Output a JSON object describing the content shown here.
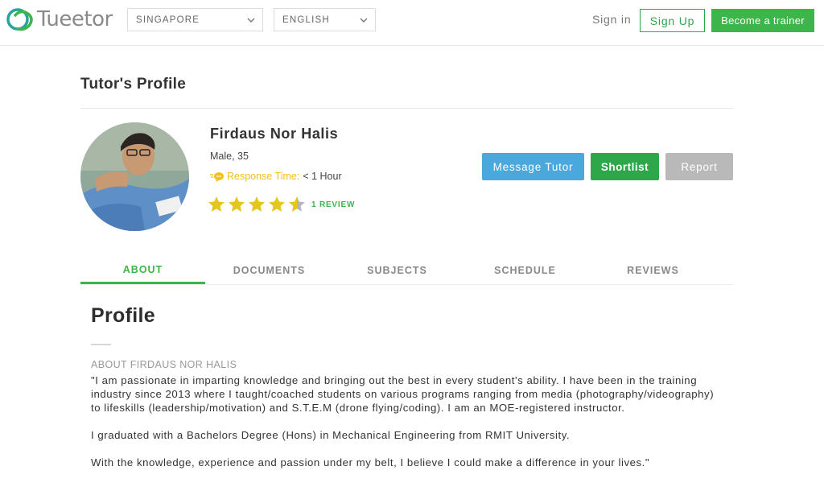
{
  "header": {
    "logo_text": "Tueetor",
    "country": "SINGAPORE",
    "language": "ENGLISH",
    "sign_in": "Sign in",
    "sign_up": "Sign Up",
    "become_trainer": "Become a trainer",
    "brand_color": "#3cb54a"
  },
  "page_title": "Tutor's Profile",
  "tutor": {
    "name": "Firdaus Nor Halis",
    "meta": "Male, 35",
    "response_label": "Response Time:",
    "response_value": "< 1 Hour",
    "rating": 4.5,
    "rating_max": 5,
    "review_link": "1 REVIEW"
  },
  "actions": {
    "message": "Message Tutor",
    "shortlist": "Shortlist",
    "report": "Report"
  },
  "tabs": [
    {
      "label": "ABOUT",
      "active": true
    },
    {
      "label": "DOCUMENTS",
      "active": false
    },
    {
      "label": "SUBJECTS",
      "active": false
    },
    {
      "label": "SCHEDULE",
      "active": false
    },
    {
      "label": "REVIEWS",
      "active": false
    }
  ],
  "profile": {
    "section_title": "Profile",
    "about_label": "ABOUT FIRDAUS NOR HALIS",
    "paragraphs": [
      "\"I am passionate in imparting knowledge and bringing out the best in every student's ability. I have been in the training industry since 2013 where I taught/coached students on various programs ranging from media (photography/videography) to lifeskills (leadership/motivation) and S.T.E.M (drone flying/coding). I am an MOE-registered instructor.",
      "I graduated with a Bachelors Degree (Hons) in Mechanical Engineering from RMIT University.",
      "With the knowledge, experience and passion under my belt, I believe I could make a difference in your lives.\""
    ]
  }
}
